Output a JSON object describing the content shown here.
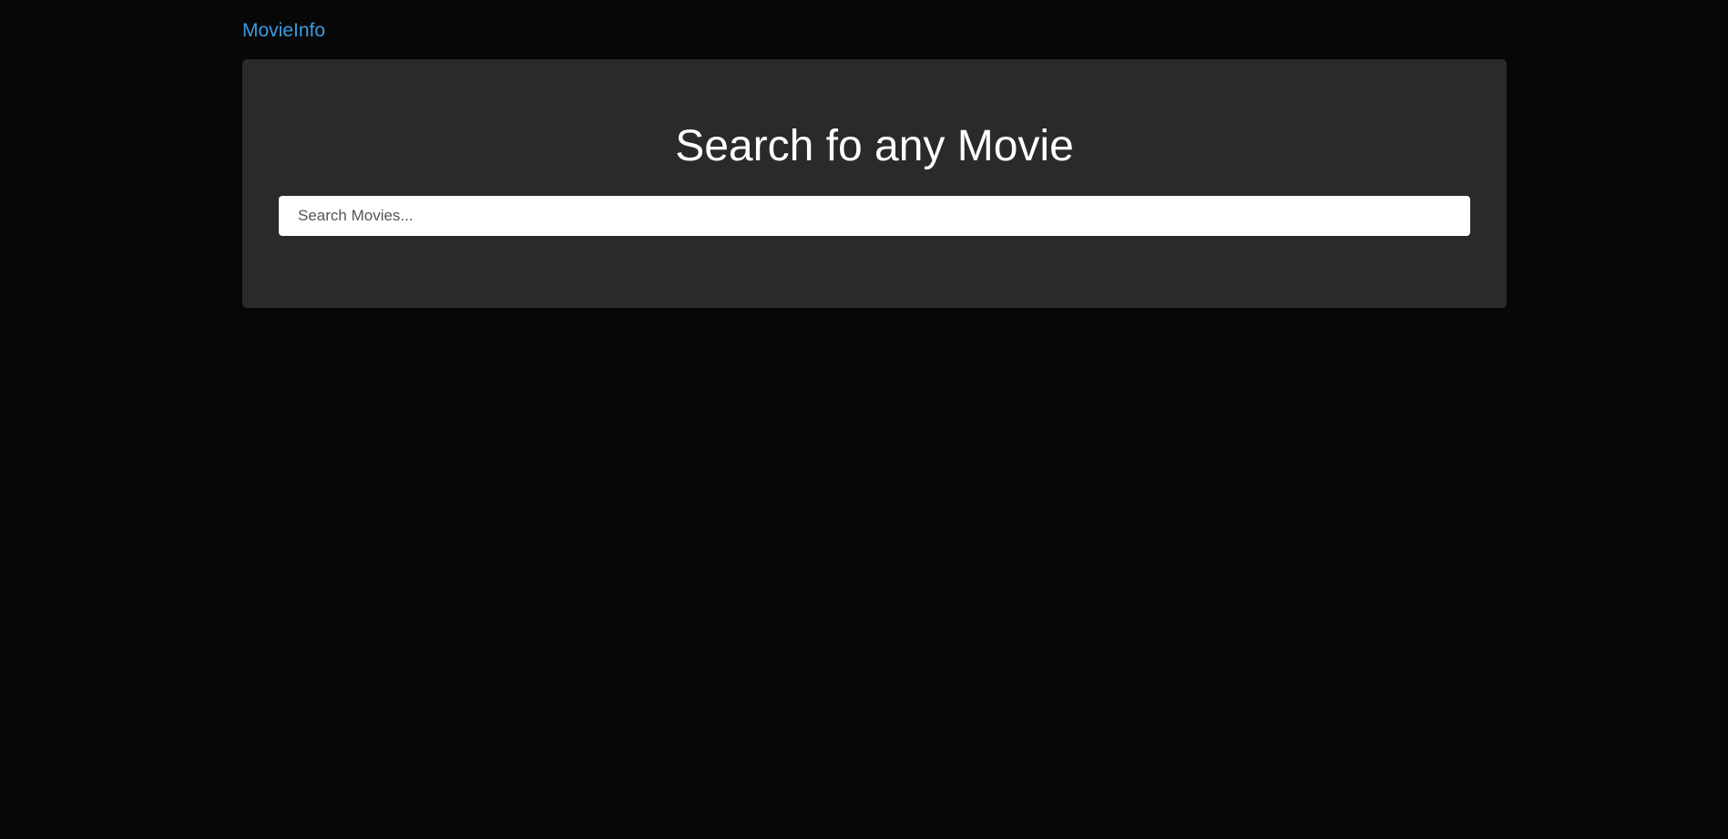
{
  "navbar": {
    "brand": "MovieInfo"
  },
  "hero": {
    "title": "Search fo any Movie",
    "search": {
      "placeholder": "Search Movies...",
      "value": ""
    }
  },
  "colors": {
    "background": "#070707",
    "panel": "#2a2a2a",
    "brand": "#3b9be0",
    "title": "#ffffff",
    "input_background": "#ffffff"
  }
}
